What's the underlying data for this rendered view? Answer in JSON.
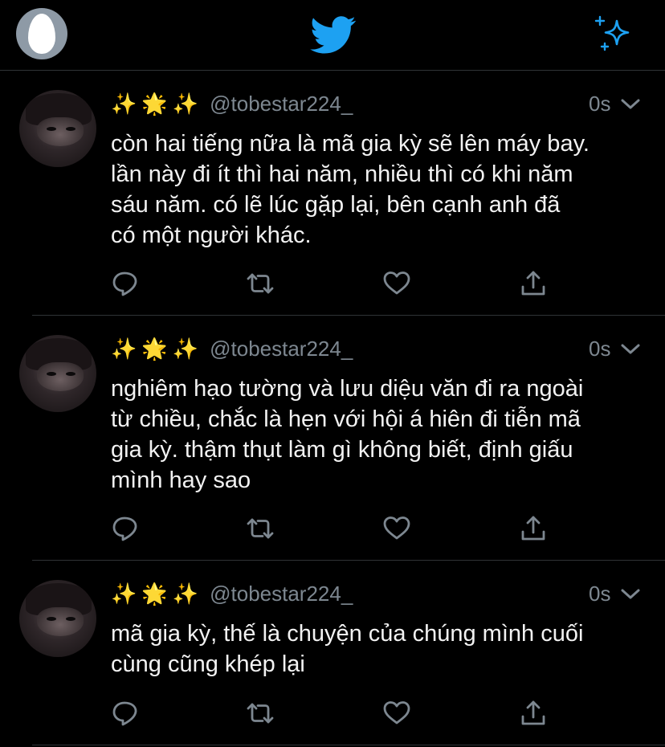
{
  "header": {
    "profile_icon": "egg-avatar-icon",
    "logo_icon": "twitter-bird-icon",
    "top_right_icon": "sparkle-icon"
  },
  "colors": {
    "background": "#000000",
    "accent": "#1da1f2",
    "secondary_text": "#7d8790",
    "divider": "#2f3336"
  },
  "tweets": [
    {
      "emoji_prefix": [
        "✨",
        "🌟",
        "✨"
      ],
      "handle": "@tobestar224_",
      "time": "0s",
      "text_lines": [
        "còn hai tiếng nữa là mã gia kỳ sẽ lên máy bay.",
        "lần này đi ít thì hai năm, nhiều thì có khi năm",
        "sáu năm. có lẽ lúc gặp lại, bên cạnh anh đã",
        "có một người khác."
      ]
    },
    {
      "emoji_prefix": [
        "✨",
        "🌟",
        "✨"
      ],
      "handle": "@tobestar224_",
      "time": "0s",
      "text_lines": [
        "nghiêm hạo tường và lưu diệu văn đi ra ngoài",
        "từ chiều, chắc là hẹn với hội á hiên đi tiễn mã",
        "gia kỳ. thậm thụt làm gì không biết, định giấu",
        "mình hay sao"
      ]
    },
    {
      "emoji_prefix": [
        "✨",
        "🌟",
        "✨"
      ],
      "handle": "@tobestar224_",
      "time": "0s",
      "text_lines": [
        "mã gia kỳ, thế là chuyện của chúng mình cuối",
        "cùng cũng khép lại"
      ]
    }
  ],
  "actions": {
    "reply_icon": "reply-icon",
    "retweet_icon": "retweet-icon",
    "like_icon": "heart-icon",
    "share_icon": "share-icon"
  }
}
